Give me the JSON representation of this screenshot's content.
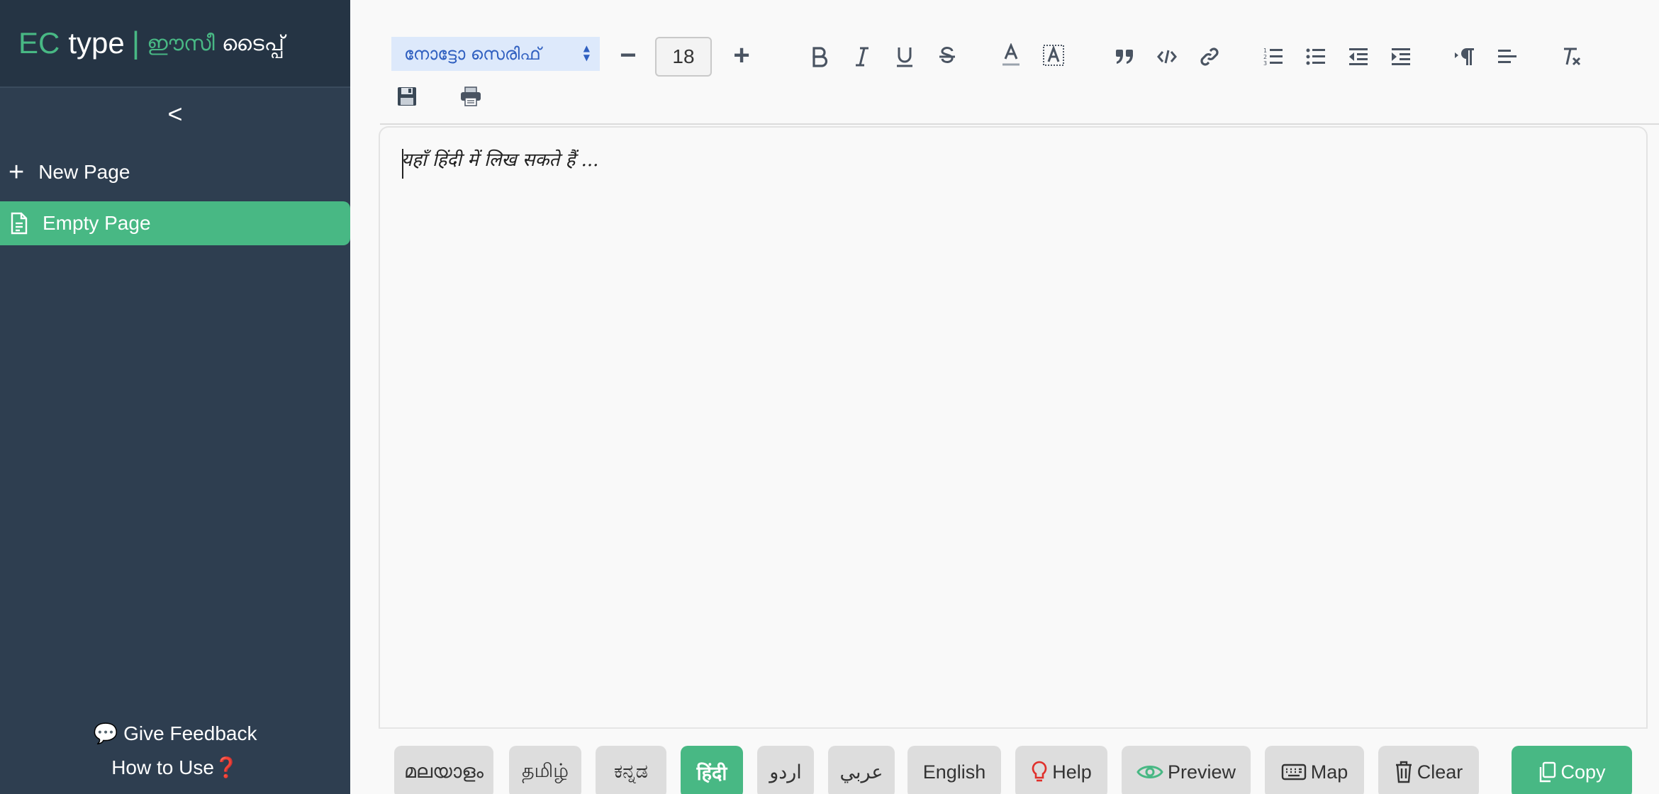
{
  "sidebar": {
    "brand_ec": "EC",
    "brand_type": "type",
    "brand_divider": "|",
    "brand_ml_1": "ഈസീ",
    "brand_ml_2": "ടൈപ്പ്",
    "collapse_label": "<",
    "new_page_label": "New Page",
    "pages": [
      {
        "label": "Empty Page",
        "active": true
      }
    ],
    "feedback_label": "Give Feedback",
    "feedback_icon": "💬",
    "howto_label": "How to Use",
    "howto_icon": "❓"
  },
  "toolbar": {
    "font_name": "നോട്ടോ സെരിഫ്",
    "font_size": "18",
    "size_minus": "−",
    "size_plus": "+"
  },
  "editor": {
    "placeholder": "यहाँ हिंदी में लिख सकते हैं ..."
  },
  "bottom_bar": {
    "languages": [
      "മലയാളം",
      "தமிழ்",
      "ಕನ್ನಡ",
      "हिंदी",
      "اردو",
      "عربي",
      "English"
    ],
    "active_language": "हिंदी",
    "help_label": "Help",
    "preview_label": "Preview",
    "map_label": "Map",
    "clear_label": "Clear",
    "copy_label": "Copy"
  },
  "colors": {
    "accent": "#48b884",
    "sidebar_bg": "#2e3e50",
    "header_bg": "#253444",
    "icon_gray": "#4a5462",
    "help_icon": "#e0302b"
  }
}
